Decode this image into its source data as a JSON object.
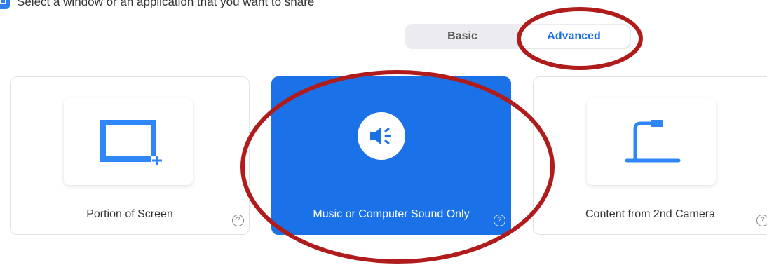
{
  "header": {
    "title": "Select a window or an application that you want to share"
  },
  "toggle": {
    "basic_label": "Basic",
    "advanced_label": "Advanced",
    "active": "Advanced"
  },
  "options": [
    {
      "label": "Portion of Screen",
      "help": "?"
    },
    {
      "label": "Music or Computer Sound Only",
      "help": "?"
    },
    {
      "label": "Content from 2nd Camera",
      "help": "?"
    }
  ],
  "colors": {
    "accent": "#1b72e8",
    "annotation": "#b01c1c"
  },
  "icons": {
    "share": "share-screen-icon",
    "portion": "portion-of-screen-icon",
    "sound": "speaker-icon",
    "camera": "document-camera-icon",
    "help": "help-icon"
  }
}
